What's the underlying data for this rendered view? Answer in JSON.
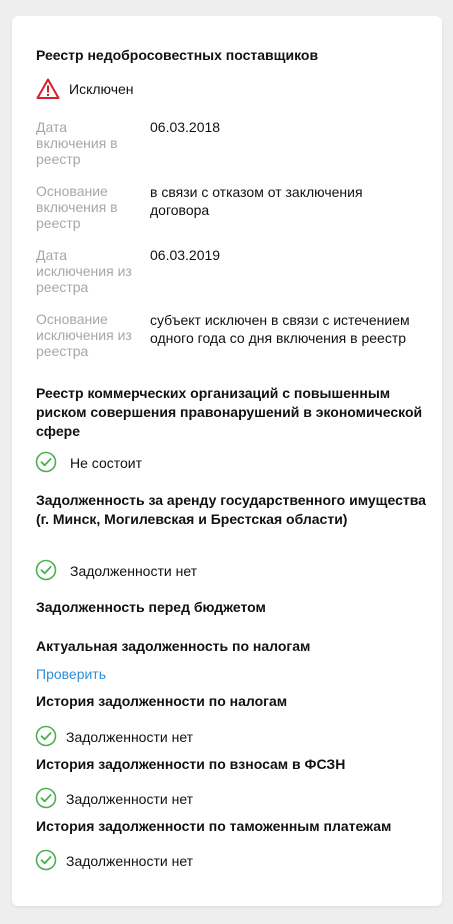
{
  "unfair_suppliers": {
    "title": "Реестр недобросовестных поставщиков",
    "status": "Исключен",
    "rows": [
      {
        "label": "Дата включения в реестр",
        "value": "06.03.2018"
      },
      {
        "label": "Основание включения в реестр",
        "value": "в связи с отказом от заключения договора"
      },
      {
        "label": "Дата исключения из реестра",
        "value": "06.03.2019"
      },
      {
        "label": "Основание исключения из реестра",
        "value": "субъект исключен в связи с истечением одного года со дня включения в реестр"
      }
    ]
  },
  "high_risk_register": {
    "title": "Реестр коммерческих организаций с повышенным риском совершения правонарушений в экономической сфере",
    "status": "Не состоит"
  },
  "rent_debt": {
    "title": "Задолженность за аренду государственного имущества (г. Минск, Могилевская и Брестская области)",
    "status": "Задолженности нет"
  },
  "budget_debt": {
    "title": "Задолженность перед бюджетом"
  },
  "current_tax_debt": {
    "title": "Актуальная задолженность по налогам",
    "link": "Проверить"
  },
  "tax_debt_history": {
    "title": "История задолженности по налогам",
    "status": "Задолженности нет"
  },
  "fszn_debt_history": {
    "title": "История задолженности по взносам в ФСЗН",
    "status": "Задолженности нет"
  },
  "customs_debt_history": {
    "title": "История задолженности по таможенным платежам",
    "status": "Задолженности нет"
  },
  "colors": {
    "warning": "#d81e2c",
    "success": "#4caf50",
    "link": "#2f8ed8",
    "label": "#a7a7a7"
  }
}
